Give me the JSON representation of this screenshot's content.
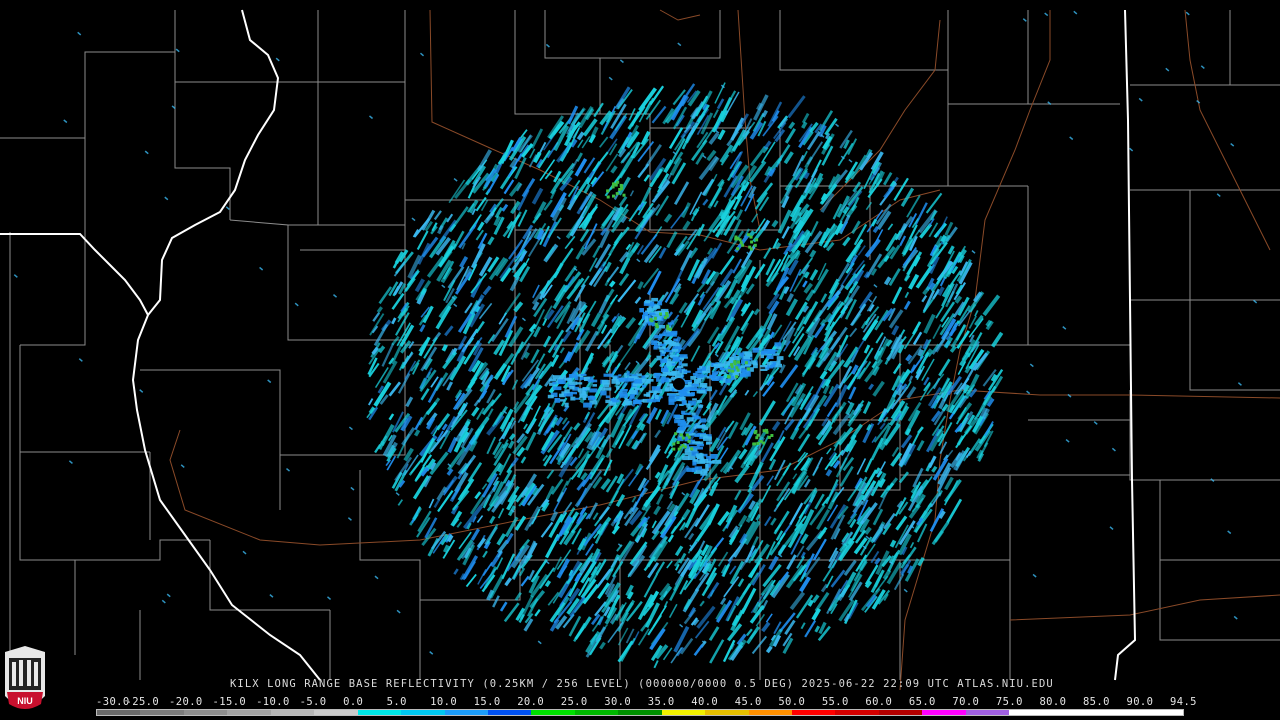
{
  "product": {
    "caption": "KILX LONG RANGE BASE REFLECTIVITY (0.25KM / 256 LEVEL) (000000/0000 0.5 DEG) 2025-06-22 22:09 UTC  ATLAS.NIU.EDU",
    "logo_text": "NIU"
  },
  "legend": {
    "ticks": [
      "-30.0",
      "-25.0",
      "-20.0",
      "-15.0",
      "-10.0",
      "-5.0",
      "0.0",
      "5.0",
      "10.0",
      "15.0",
      "20.0",
      "25.0",
      "30.0",
      "35.0",
      "40.0",
      "45.0",
      "50.0",
      "55.0",
      "60.0",
      "65.0",
      "70.0",
      "75.0",
      "80.0",
      "85.0",
      "90.0",
      "94.5"
    ],
    "colors": [
      "#6a6a6a",
      "#7c7c7c",
      "#8e8e8e",
      "#a2a2a2",
      "#b6b6b6",
      "#cacaca",
      "#00e8e8",
      "#00c8f0",
      "#1c9cf8",
      "#0050f0",
      "#00e000",
      "#00b800",
      "#009000",
      "#f0f000",
      "#e6c000",
      "#ff9000",
      "#ff0000",
      "#d40000",
      "#b40000",
      "#ff00ff",
      "#a060e0",
      "#ffffff",
      "#ffffff",
      "#ffffff",
      "#ffffff"
    ]
  },
  "colors": {
    "background": "#000000",
    "county_lines": "#8c8c8c",
    "state_lines": "#ffffff",
    "highways": "#8a4a28",
    "echo_main": "#19d2de",
    "echo_light": "#3ab8f0",
    "echo_blue": "#1f8ef0",
    "echo_green": "#3fbe3f",
    "radar_site": "#000000"
  }
}
